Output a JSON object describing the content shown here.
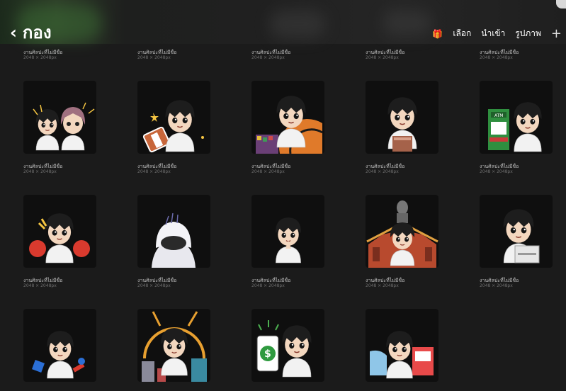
{
  "header": {
    "back_label": "กอง",
    "select_label": "เลือก",
    "import_label": "นำเข้า",
    "photo_label": "รูปภาพ",
    "add_label": "+"
  },
  "colors": {
    "accent": "#ff3b4f",
    "background": "#1b1b1b",
    "thumb_bg": "#0f0f0f"
  },
  "artworks": [
    {
      "title": "งานศิลปะที่ไม่มีชื่อ",
      "size": "2048 × 2048px"
    },
    {
      "title": "งานศิลปะที่ไม่มีชื่อ",
      "size": "2048 × 2048px"
    },
    {
      "title": "งานศิลปะที่ไม่มีชื่อ",
      "size": "2048 × 2048px"
    },
    {
      "title": "งานศิลปะที่ไม่มีชื่อ",
      "size": "2048 × 2048px"
    },
    {
      "title": "งานศิลปะที่ไม่มีชื่อ",
      "size": "2048 × 2048px"
    },
    {
      "title": "งานศิลปะที่ไม่มีชื่อ",
      "size": "2048 × 2048px"
    },
    {
      "title": "งานศิลปะที่ไม่มีชื่อ",
      "size": "2048 × 2048px"
    },
    {
      "title": "งานศิลปะที่ไม่มีชื่อ",
      "size": "2048 × 2048px"
    },
    {
      "title": "งานศิลปะที่ไม่มีชื่อ",
      "size": "2048 × 2048px"
    },
    {
      "title": "งานศิลปะที่ไม่มีชื่อ",
      "size": "2048 × 2048px"
    },
    {
      "title": "งานศิลปะที่ไม่มีชื่อ",
      "size": "2048 × 2048px"
    },
    {
      "title": "งานศิลปะที่ไม่มีชื่อ",
      "size": "2048 × 2048px"
    },
    {
      "title": "งานศิลปะที่ไม่มีชื่อ",
      "size": "2048 × 2048px"
    },
    {
      "title": "งานศิลปะที่ไม่มีชื่อ",
      "size": "2048 × 2048px"
    },
    {
      "title": "งานศิลปะที่ไม่มีชื่อ",
      "size": "2048 × 2048px"
    }
  ],
  "thumbnails": [
    {
      "kind": "two-faces",
      "icon": "sticker-two-friends-icon"
    },
    {
      "kind": "boy-with-sign",
      "icon": "sticker-boy-holding-sign-icon"
    },
    {
      "kind": "boy-with-basket",
      "icon": "sticker-boy-with-goods-icon"
    },
    {
      "kind": "boy-with-paper",
      "icon": "sticker-boy-holding-paper-icon"
    },
    {
      "kind": "boy-atm",
      "icon": "sticker-boy-atm-icon"
    },
    {
      "kind": "boy-drums",
      "icon": "sticker-boy-drums-icon"
    },
    {
      "kind": "hooded",
      "icon": "sticker-hooded-figure-icon"
    },
    {
      "kind": "boy-pray",
      "icon": "sticker-boy-praying-icon"
    },
    {
      "kind": "boy-temple",
      "icon": "sticker-boy-temple-icon"
    },
    {
      "kind": "boy-card",
      "icon": "sticker-boy-card-icon"
    },
    {
      "kind": "boy-toys",
      "icon": "sticker-boy-toys-icon"
    },
    {
      "kind": "boy-city",
      "icon": "sticker-boy-city-icon"
    },
    {
      "kind": "boy-money",
      "icon": "sticker-boy-money-phone-icon"
    },
    {
      "kind": "boy-market",
      "icon": "sticker-boy-market-icon"
    }
  ]
}
